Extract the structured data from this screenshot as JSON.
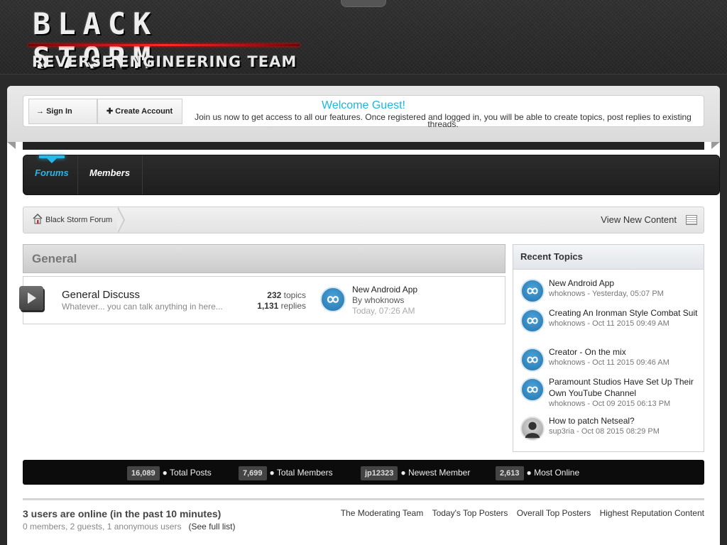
{
  "logo": {
    "top": "BLACK STORM",
    "bottom": "REVERSE ENGINEERING TEAM"
  },
  "guest": {
    "signin_label": "Sign In",
    "create_label": "Create Account",
    "welcome_title": "Welcome Guest!",
    "welcome_text": "Join us now to get access to all our features. Once registered and logged in, you will be able to create topics, post replies to existing threads."
  },
  "nav": {
    "tabs": [
      {
        "label": "Forums",
        "active": true
      },
      {
        "label": "Members"
      }
    ]
  },
  "breadcrumb": {
    "home": "Black Storm Forum",
    "view_new": "View New Content"
  },
  "category": {
    "title": "General",
    "forum": {
      "name": "General Discuss",
      "description": "Whatever... you can talk anything in here...",
      "topics_count": "232",
      "topics_label": "topics",
      "replies_count": "1,131",
      "replies_label": "replies",
      "last_post_title": "New Android App",
      "last_post_by_prefix": "By",
      "last_post_author": "whoknows",
      "last_post_time": "Today, 07:26 AM"
    }
  },
  "recent": {
    "title": "Recent Topics",
    "items": [
      {
        "title": "New Android App",
        "author": "whoknows",
        "date": "Yesterday, 05:07 PM",
        "avatar": "whoknows-logo"
      },
      {
        "title": "Creating An Ironman Style Combat Suit",
        "author": "whoknows",
        "date": "Oct 11 2015 09:49 AM",
        "avatar": "whoknows-logo"
      },
      {
        "title": "Creator - On the mix",
        "author": "whoknows",
        "date": "Oct 11 2015 09:46 AM",
        "avatar": "whoknows-logo"
      },
      {
        "title": "Paramount Studios Have Set Up Their Own YouTube Channel",
        "author": "whoknows",
        "date": "Oct 09 2015 06:13 PM",
        "avatar": "whoknows-logo"
      },
      {
        "title": "How to patch Netseal?",
        "author": "sup3ria",
        "date": "Oct 08 2015 08:29 PM",
        "avatar": "default-user"
      }
    ]
  },
  "stats": {
    "total_posts": "16,089",
    "total_posts_label": "Total Posts",
    "total_members": "7,699",
    "total_members_label": "Total Members",
    "newest_member": "jp12323",
    "newest_member_label": "Newest Member",
    "most_online": "2,613",
    "most_online_label": "Most Online"
  },
  "online": {
    "title": "3 users are online (in the past 10 minutes)",
    "detail": "0 members, 2 guests, 1 anonymous users",
    "full_list": "(See full list)",
    "links": [
      "The Moderating Team",
      "Today's Top Posters",
      "Overall Top Posters",
      "Highest Reputation Content"
    ]
  },
  "colors": {
    "accent": "#23b9e8",
    "welcome": "#1ab8e0",
    "logo_line": "#ff2a2a"
  }
}
